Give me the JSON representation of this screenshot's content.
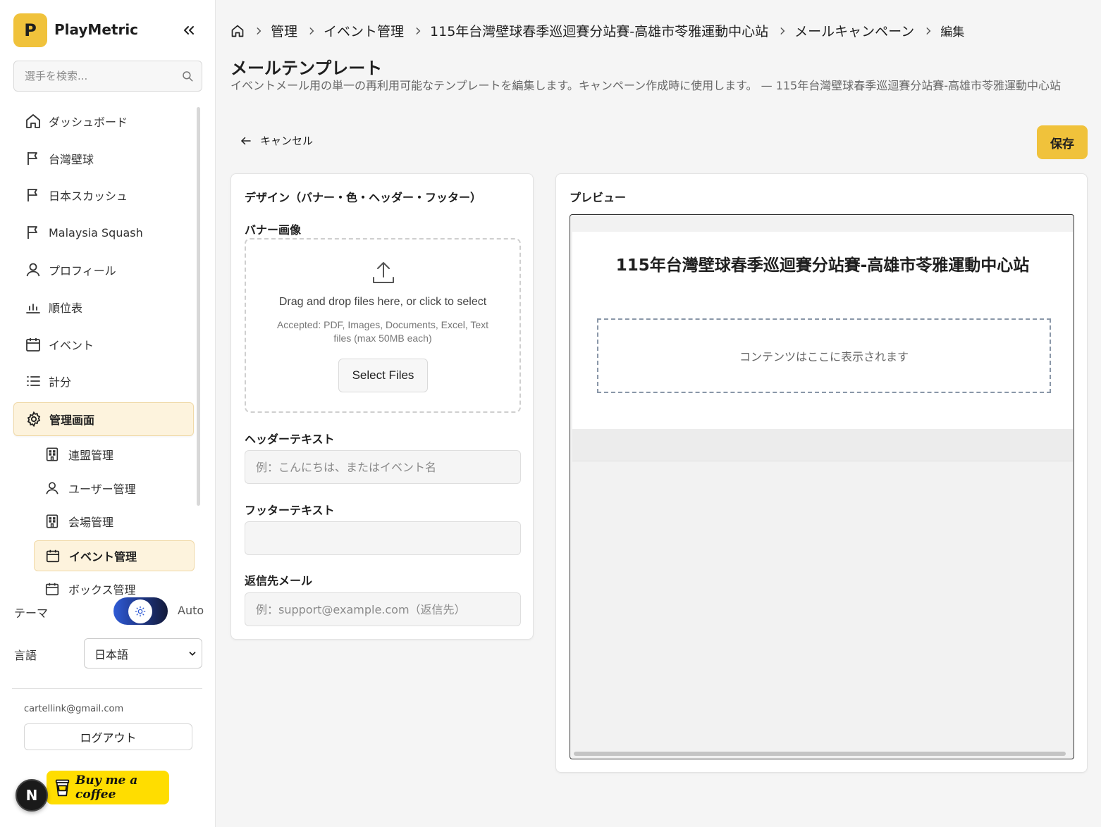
{
  "app": {
    "logo_letter": "P",
    "name": "PlayMetric",
    "brand_color": "#f0c23b"
  },
  "search": {
    "placeholder": "選手を検索..."
  },
  "nav": {
    "items": [
      {
        "label": "ダッシュボード",
        "icon": "home-icon"
      },
      {
        "label": "台灣壁球",
        "icon": "flag-icon"
      },
      {
        "label": "日本スカッシュ",
        "icon": "flag-icon"
      },
      {
        "label": "Malaysia Squash",
        "icon": "flag-icon"
      },
      {
        "label": "プロフィール",
        "icon": "user-icon"
      },
      {
        "label": "順位表",
        "icon": "bar-chart-icon"
      },
      {
        "label": "イベント",
        "icon": "calendar-icon"
      },
      {
        "label": "計分",
        "icon": "list-icon"
      },
      {
        "label": "管理画面",
        "icon": "gear-icon",
        "active": true
      }
    ],
    "sub_items": [
      {
        "label": "連盟管理",
        "icon": "building-icon"
      },
      {
        "label": "ユーザー管理",
        "icon": "user-icon"
      },
      {
        "label": "会場管理",
        "icon": "building-icon"
      },
      {
        "label": "イベント管理",
        "icon": "calendar-icon",
        "active": true
      },
      {
        "label": "ボックス管理",
        "icon": "calendar-icon"
      }
    ]
  },
  "settings": {
    "theme_label": "テーマ",
    "theme_value": "Auto",
    "language_label": "言語",
    "language_value": "日本語"
  },
  "account": {
    "email": "cartellink@gmail.com",
    "logout_label": "ログアウト"
  },
  "badges": {
    "next_letter": "N",
    "bmc_label": "Buy me a coffee"
  },
  "breadcrumb": {
    "items": [
      "管理",
      "イベント管理",
      "115年台灣壁球春季巡迴賽分站賽-高雄市苓雅運動中心站",
      "メールキャンペーン"
    ],
    "current": "編集"
  },
  "page": {
    "title": "メールテンプレート",
    "description": "イベントメール用の単一の再利用可能なテンプレートを編集します。キャンペーン作成時に使用します。 — 115年台灣壁球春季巡迴賽分站賽-高雄市苓雅運動中心站",
    "cancel_label": "キャンセル",
    "save_label": "保存"
  },
  "design": {
    "title": "デザイン（バナー・色・ヘッダー・フッター）",
    "banner_label": "バナー画像",
    "dropzone_text": "Drag and drop files here, or click to select",
    "dropzone_hint": "Accepted: PDF, Images, Documents, Excel, Text files (max 50MB each)",
    "select_files_label": "Select Files",
    "header_label": "ヘッダーテキスト",
    "header_placeholder": "例：こんにちは、またはイベント名",
    "header_value": "",
    "footer_label": "フッターテキスト",
    "footer_value": "",
    "reply_label": "返信先メール",
    "reply_placeholder": "例：support@example.com（返信先）",
    "reply_value": ""
  },
  "preview": {
    "title": "プレビュー",
    "email_title": "115年台灣壁球春季巡迴賽分站賽-高雄市苓雅運動中心站",
    "content_placeholder": "コンテンツはここに表示されます"
  }
}
